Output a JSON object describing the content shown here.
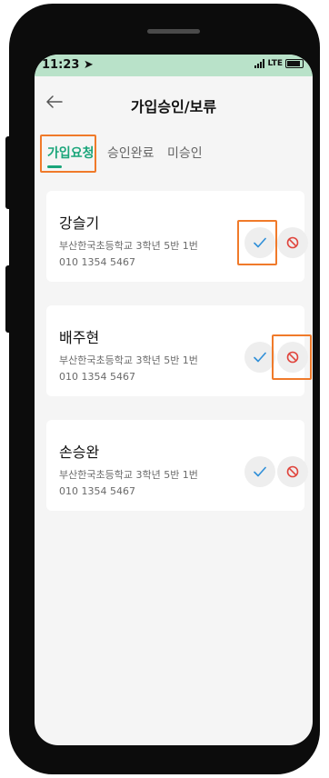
{
  "status_bar": {
    "time": "11:23",
    "network": "LTE"
  },
  "header": {
    "title": "가입승인/보류",
    "back_icon": "arrow-left-icon"
  },
  "tabs": [
    {
      "label": "가입요청",
      "active": true
    },
    {
      "label": "승인완료",
      "active": false
    },
    {
      "label": "미승인",
      "active": false
    }
  ],
  "requests": [
    {
      "name": "강슬기",
      "school_info": "부산한국초등학교  3학년 5반 1번",
      "phone": "010 1354 5467"
    },
    {
      "name": "배주현",
      "school_info": "부산한국초등학교  3학년 5반 1번",
      "phone": "010 1354 5467"
    },
    {
      "name": "손승완",
      "school_info": "부산한국초등학교  3학년 5반 1번",
      "phone": "010 1354 5467"
    }
  ],
  "colors": {
    "accent": "#1aa57a",
    "status_bar_bg": "#b9e2c9",
    "approve_check": "#2f8fd8",
    "reject_icon": "#e0443c",
    "highlight": "#f07a2a"
  }
}
